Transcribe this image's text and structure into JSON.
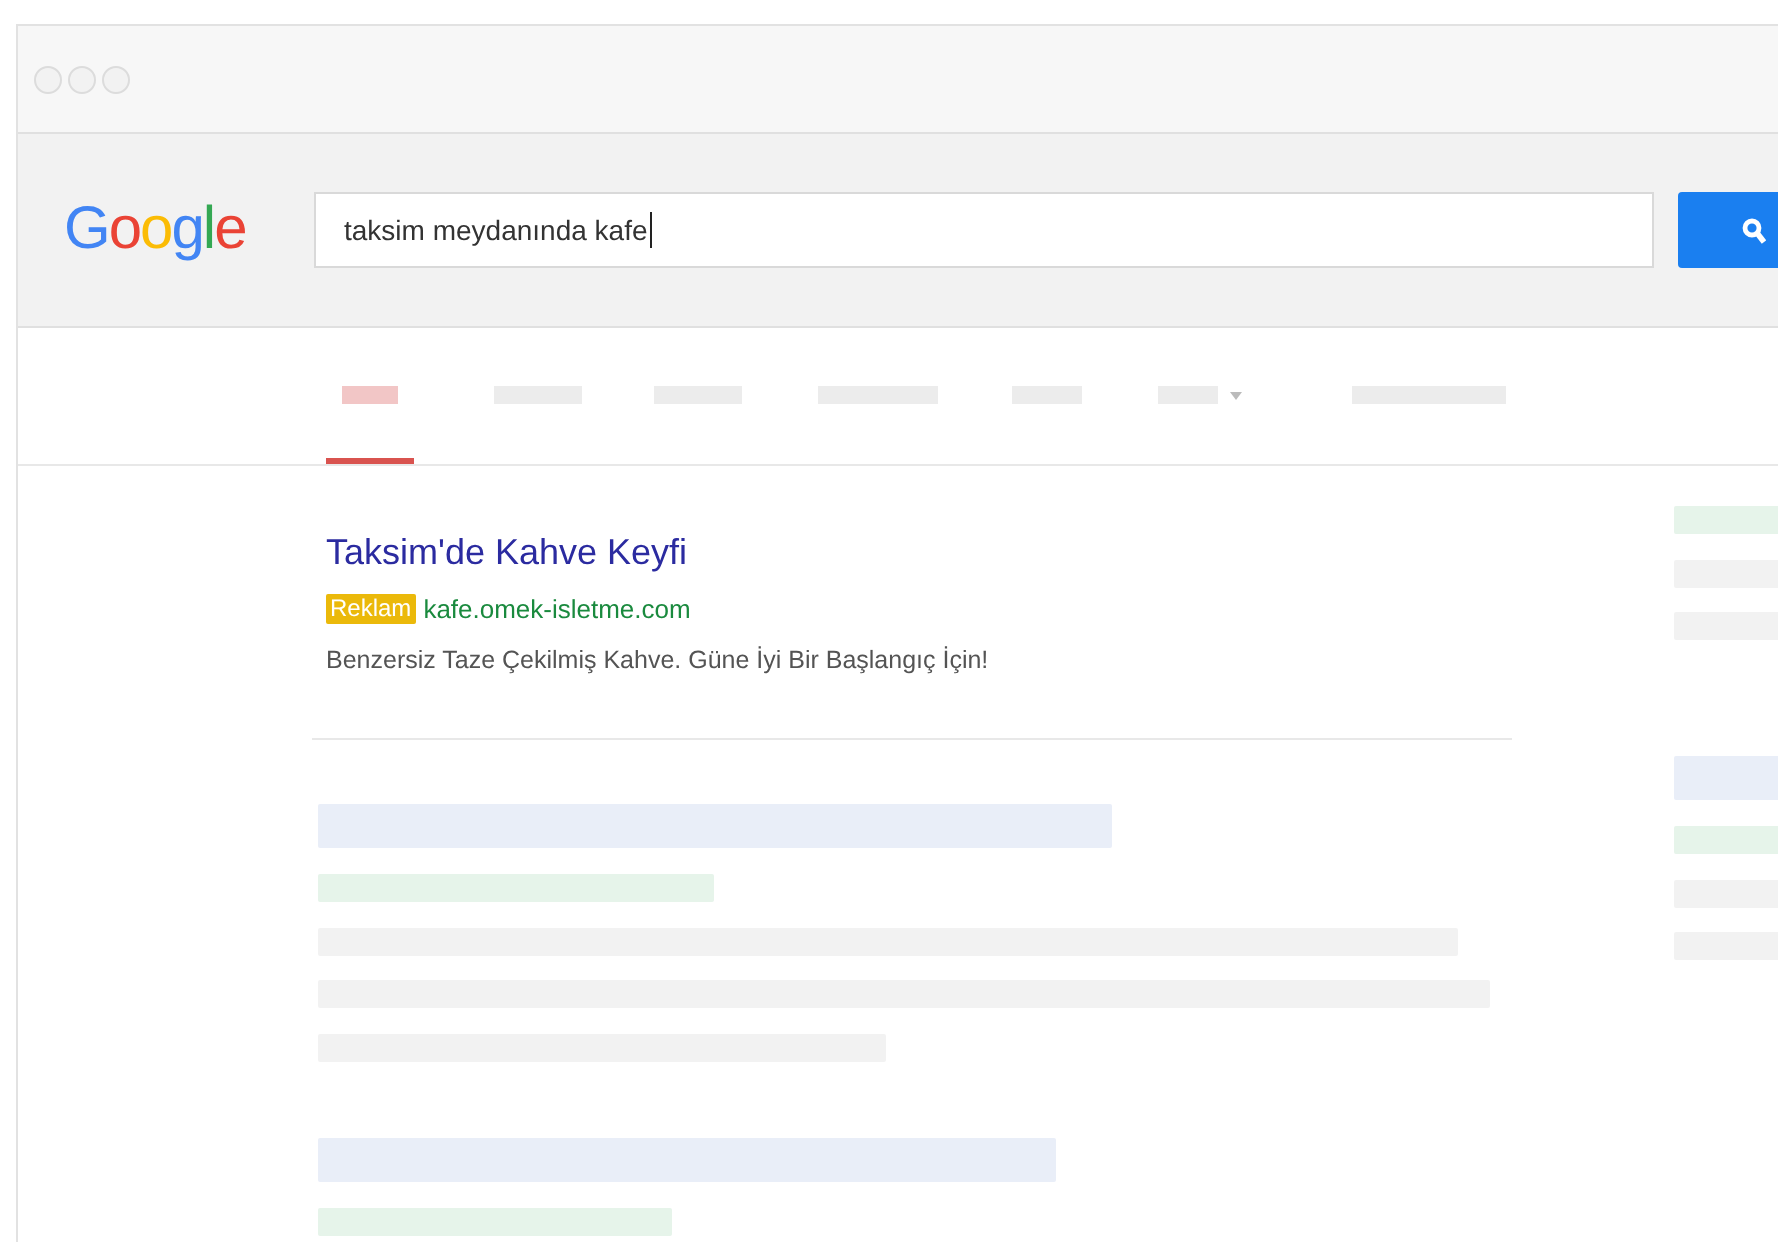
{
  "header": {
    "logo": "Google",
    "search": {
      "value": "taksim meydanında kafe",
      "focused": true
    }
  },
  "tabs": [
    {
      "selected": true,
      "menu": false
    },
    {
      "selected": false,
      "menu": false
    },
    {
      "selected": false,
      "menu": false
    },
    {
      "selected": false,
      "menu": false
    },
    {
      "selected": false,
      "menu": false
    },
    {
      "selected": false,
      "menu": true
    },
    {
      "selected": false,
      "menu": false
    }
  ],
  "ad": {
    "title": "Taksim'de Kahve Keyfi",
    "badge": "Reklam",
    "url": "kafe.omek-isletme.com",
    "description": "Benzersiz Taze Çekilmiş Kahve. Güne İyi Bir Başlangıç İçin!"
  }
}
